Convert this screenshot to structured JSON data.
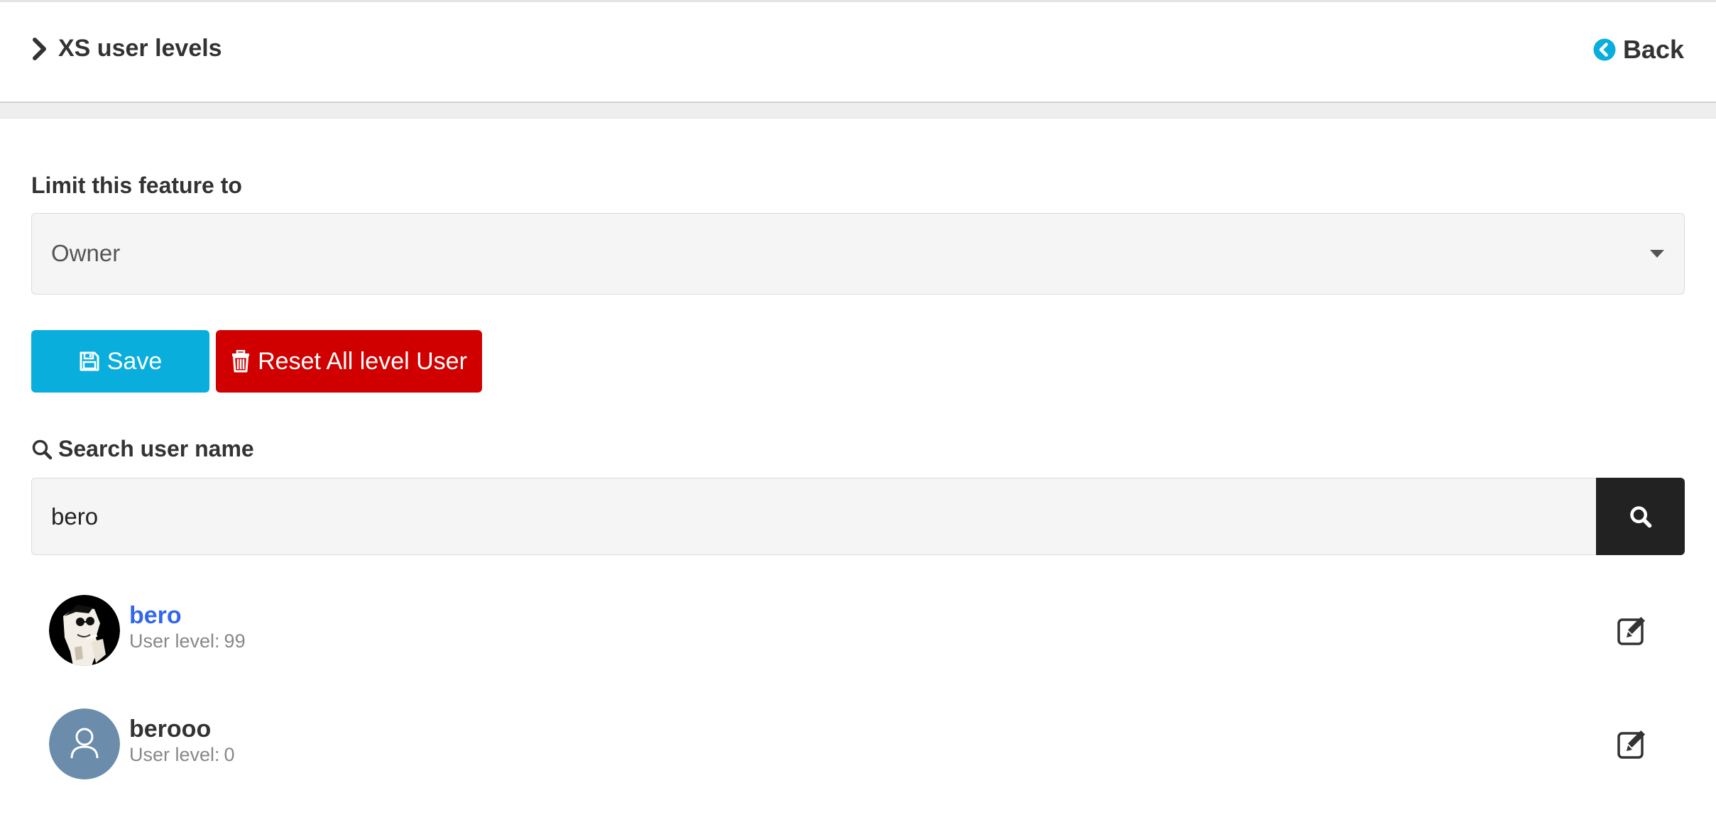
{
  "header": {
    "title": "XS user levels",
    "back_label": "Back",
    "back_icon_color": "#0aaedc"
  },
  "limit": {
    "label": "Limit this feature to",
    "selected": "Owner"
  },
  "actions": {
    "save_label": "Save",
    "save_color": "#0aaedc",
    "reset_label": "Reset All level User",
    "reset_color": "#d10000"
  },
  "search": {
    "label": "Search user name",
    "value": "bero"
  },
  "users": [
    {
      "name": "bero",
      "level_label": "User level:",
      "level": "99",
      "avatar": "photo-avatar",
      "name_color": "#3366ee"
    },
    {
      "name": "berooo",
      "level_label": "User level:",
      "level": "0",
      "avatar": "default-person-avatar",
      "name_color": "#333333"
    }
  ]
}
